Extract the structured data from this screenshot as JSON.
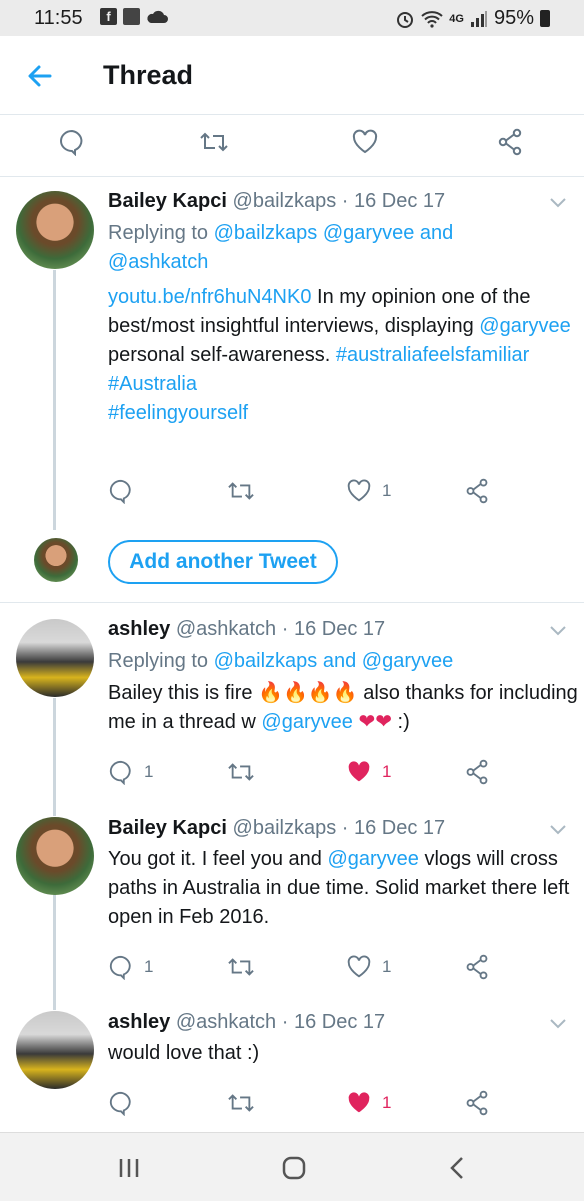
{
  "status": {
    "time": "11:55",
    "network": "4G",
    "battery": "95%"
  },
  "header": {
    "title": "Thread"
  },
  "tweets": [
    {
      "name": "Bailey Kapci",
      "handle": "@bailzkaps",
      "date": "· 16 Dec 17",
      "replying_prefix": "Replying to ",
      "replying_a": "@bailzkaps",
      "replying_b": "@garyvee",
      "replying_and": " and",
      "replying_c": "@ashkatch",
      "link": "youtu.be/nfr6huN4NK0",
      "text_a": " In my opinion one of the best/most insightful interviews, displaying ",
      "mention": "@garyvee",
      "text_b": " personal self-awareness. ",
      "tag1": "#australiafeelsfamiliar",
      "tag2": "#Australia",
      "tag3": "#feelingyourself",
      "likes": "1"
    },
    {
      "name": "ashley",
      "handle": "@ashkatch",
      "date": "· 16 Dec 17",
      "replying_prefix": "Replying to ",
      "replying_a": "@bailzkaps",
      "replying_and": " and ",
      "replying_b": "@garyvee",
      "text_a": "Bailey this is fire ",
      "emoji": "🔥🔥🔥🔥",
      "text_b": " also thanks for including me in a thread w ",
      "mention": "@garyvee",
      "hearts": "❤❤",
      "text_c": " :)",
      "replies": "1",
      "likes": "1"
    },
    {
      "name": "Bailey Kapci",
      "handle": "@bailzkaps",
      "date": "· 16 Dec 17",
      "text_a": "You got it. I feel you and ",
      "mention": "@garyvee",
      "text_b": "  vlogs will cross paths in Australia in due time. Solid market there left open in Feb 2016.",
      "replies": "1",
      "likes": "1"
    },
    {
      "name": "ashley",
      "handle": "@ashkatch",
      "date": "· 16 Dec 17",
      "text_a": "would love that :)",
      "likes": "1"
    }
  ],
  "add_tweet_label": "Add another Tweet",
  "colors": {
    "accent": "#1da1f2",
    "like": "#e0245e",
    "muted": "#657786"
  },
  "icons": [
    "back-arrow-icon",
    "reply-icon",
    "retweet-icon",
    "heart-icon",
    "share-icon",
    "chevron-down-icon",
    "recents-icon",
    "home-icon",
    "back-nav-icon"
  ]
}
